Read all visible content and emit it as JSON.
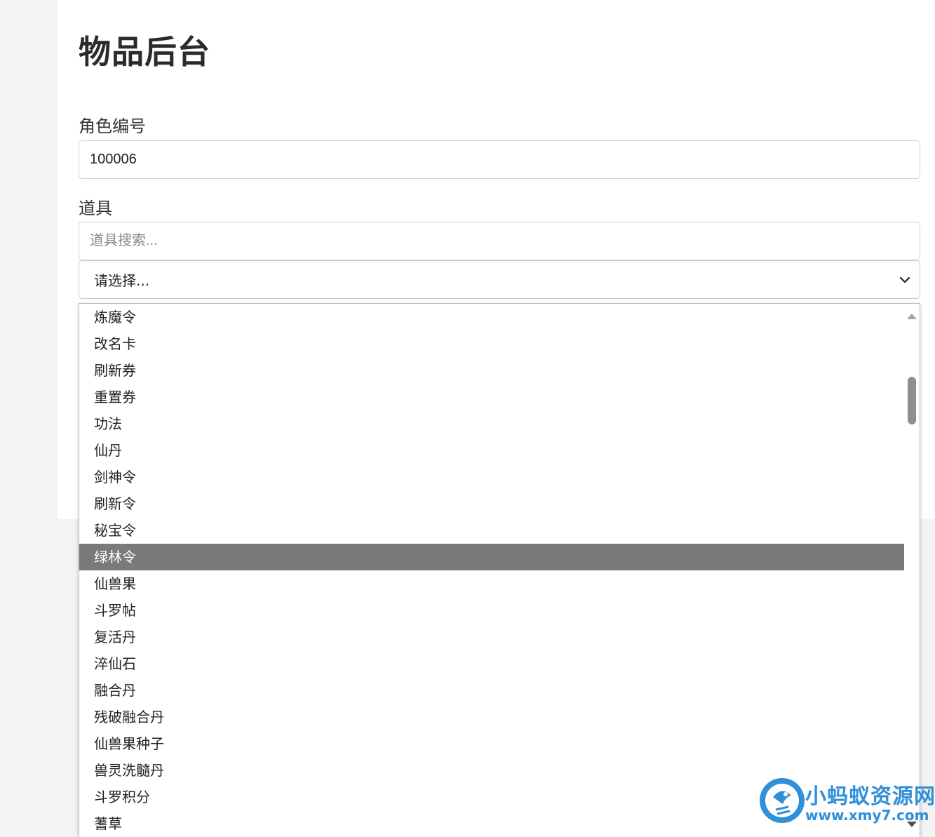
{
  "page": {
    "title": "物品后台"
  },
  "form": {
    "role_label": "角色编号",
    "role_value": "100006",
    "item_label": "道具",
    "item_search_placeholder": "道具搜索...",
    "item_select_value": "请选择..."
  },
  "dropdown": {
    "options": [
      "炼魔令",
      "改名卡",
      "刷新券",
      "重置券",
      "功法",
      "仙丹",
      "剑神令",
      "刷新令",
      "秘宝令",
      "绿林令",
      "仙兽果",
      "斗罗帖",
      "复活丹",
      "淬仙石",
      "融合丹",
      "残破融合丹",
      "仙兽果种子",
      "兽灵洗髓丹",
      "斗罗积分",
      "蓍草"
    ],
    "highlighted": "绿林令"
  },
  "watermark": {
    "name": "小蚂蚁资源网",
    "url": "www.xmy7.com",
    "color": "#2f8fd8"
  }
}
